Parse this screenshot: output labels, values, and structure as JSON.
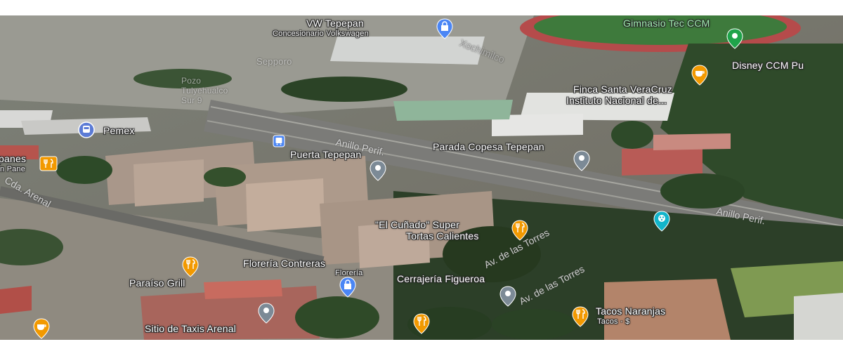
{
  "places": {
    "vw": {
      "name": "VW Tepepan",
      "sub": "Concesionario Volkswagen"
    },
    "gimnasio": "Gimnasio Tec CCM",
    "disney": "Disney CCM Pu",
    "finca": {
      "line1": "Finca Santa VeraCruz",
      "line2": "Instituto Nacional de..."
    },
    "pemex": "Pemex",
    "parada": "Parada Copesa Tepepan",
    "puerta": "Puerta Tepepan",
    "panaderia": {
      "line1": "panes",
      "line2": "n Pane"
    },
    "cunado": {
      "line1": "\"El Cuñado\" Super",
      "line2": "Tortas Calientes"
    },
    "floreria": {
      "name": "Florería Contreras",
      "sub": "Florería"
    },
    "paraiso": "Paraíso Grill",
    "cerrajeria": "Cerrajería Figueroa",
    "tacos": {
      "name": "Tacos Naranjas",
      "sub": "Tacos · $"
    },
    "sitio": "Sitio de Taxis Arenal",
    "faint_sepporo": "Sepporo",
    "faint_pozo": {
      "line1": "Pozo",
      "line2": "Tulyehualco",
      "line3": "Sur 9"
    },
    "faint_xochimilco": "Xochimilco"
  },
  "roads": {
    "anillo1": "Anillo Perif.",
    "anillo2": "Anillo Perif.",
    "torres1": "Av. de las Torres",
    "torres2": "Av. de las Torres",
    "arenal": "Cda. Arenal"
  },
  "colors": {
    "restaurant_pin": "#f29900",
    "shopping_pin": "#4b86f5",
    "transit_pin": "#5b7bd5",
    "grey_pin": "#7c8a96",
    "green_pin": "#1fa34a",
    "attraction_pin": "#12b5cb"
  }
}
